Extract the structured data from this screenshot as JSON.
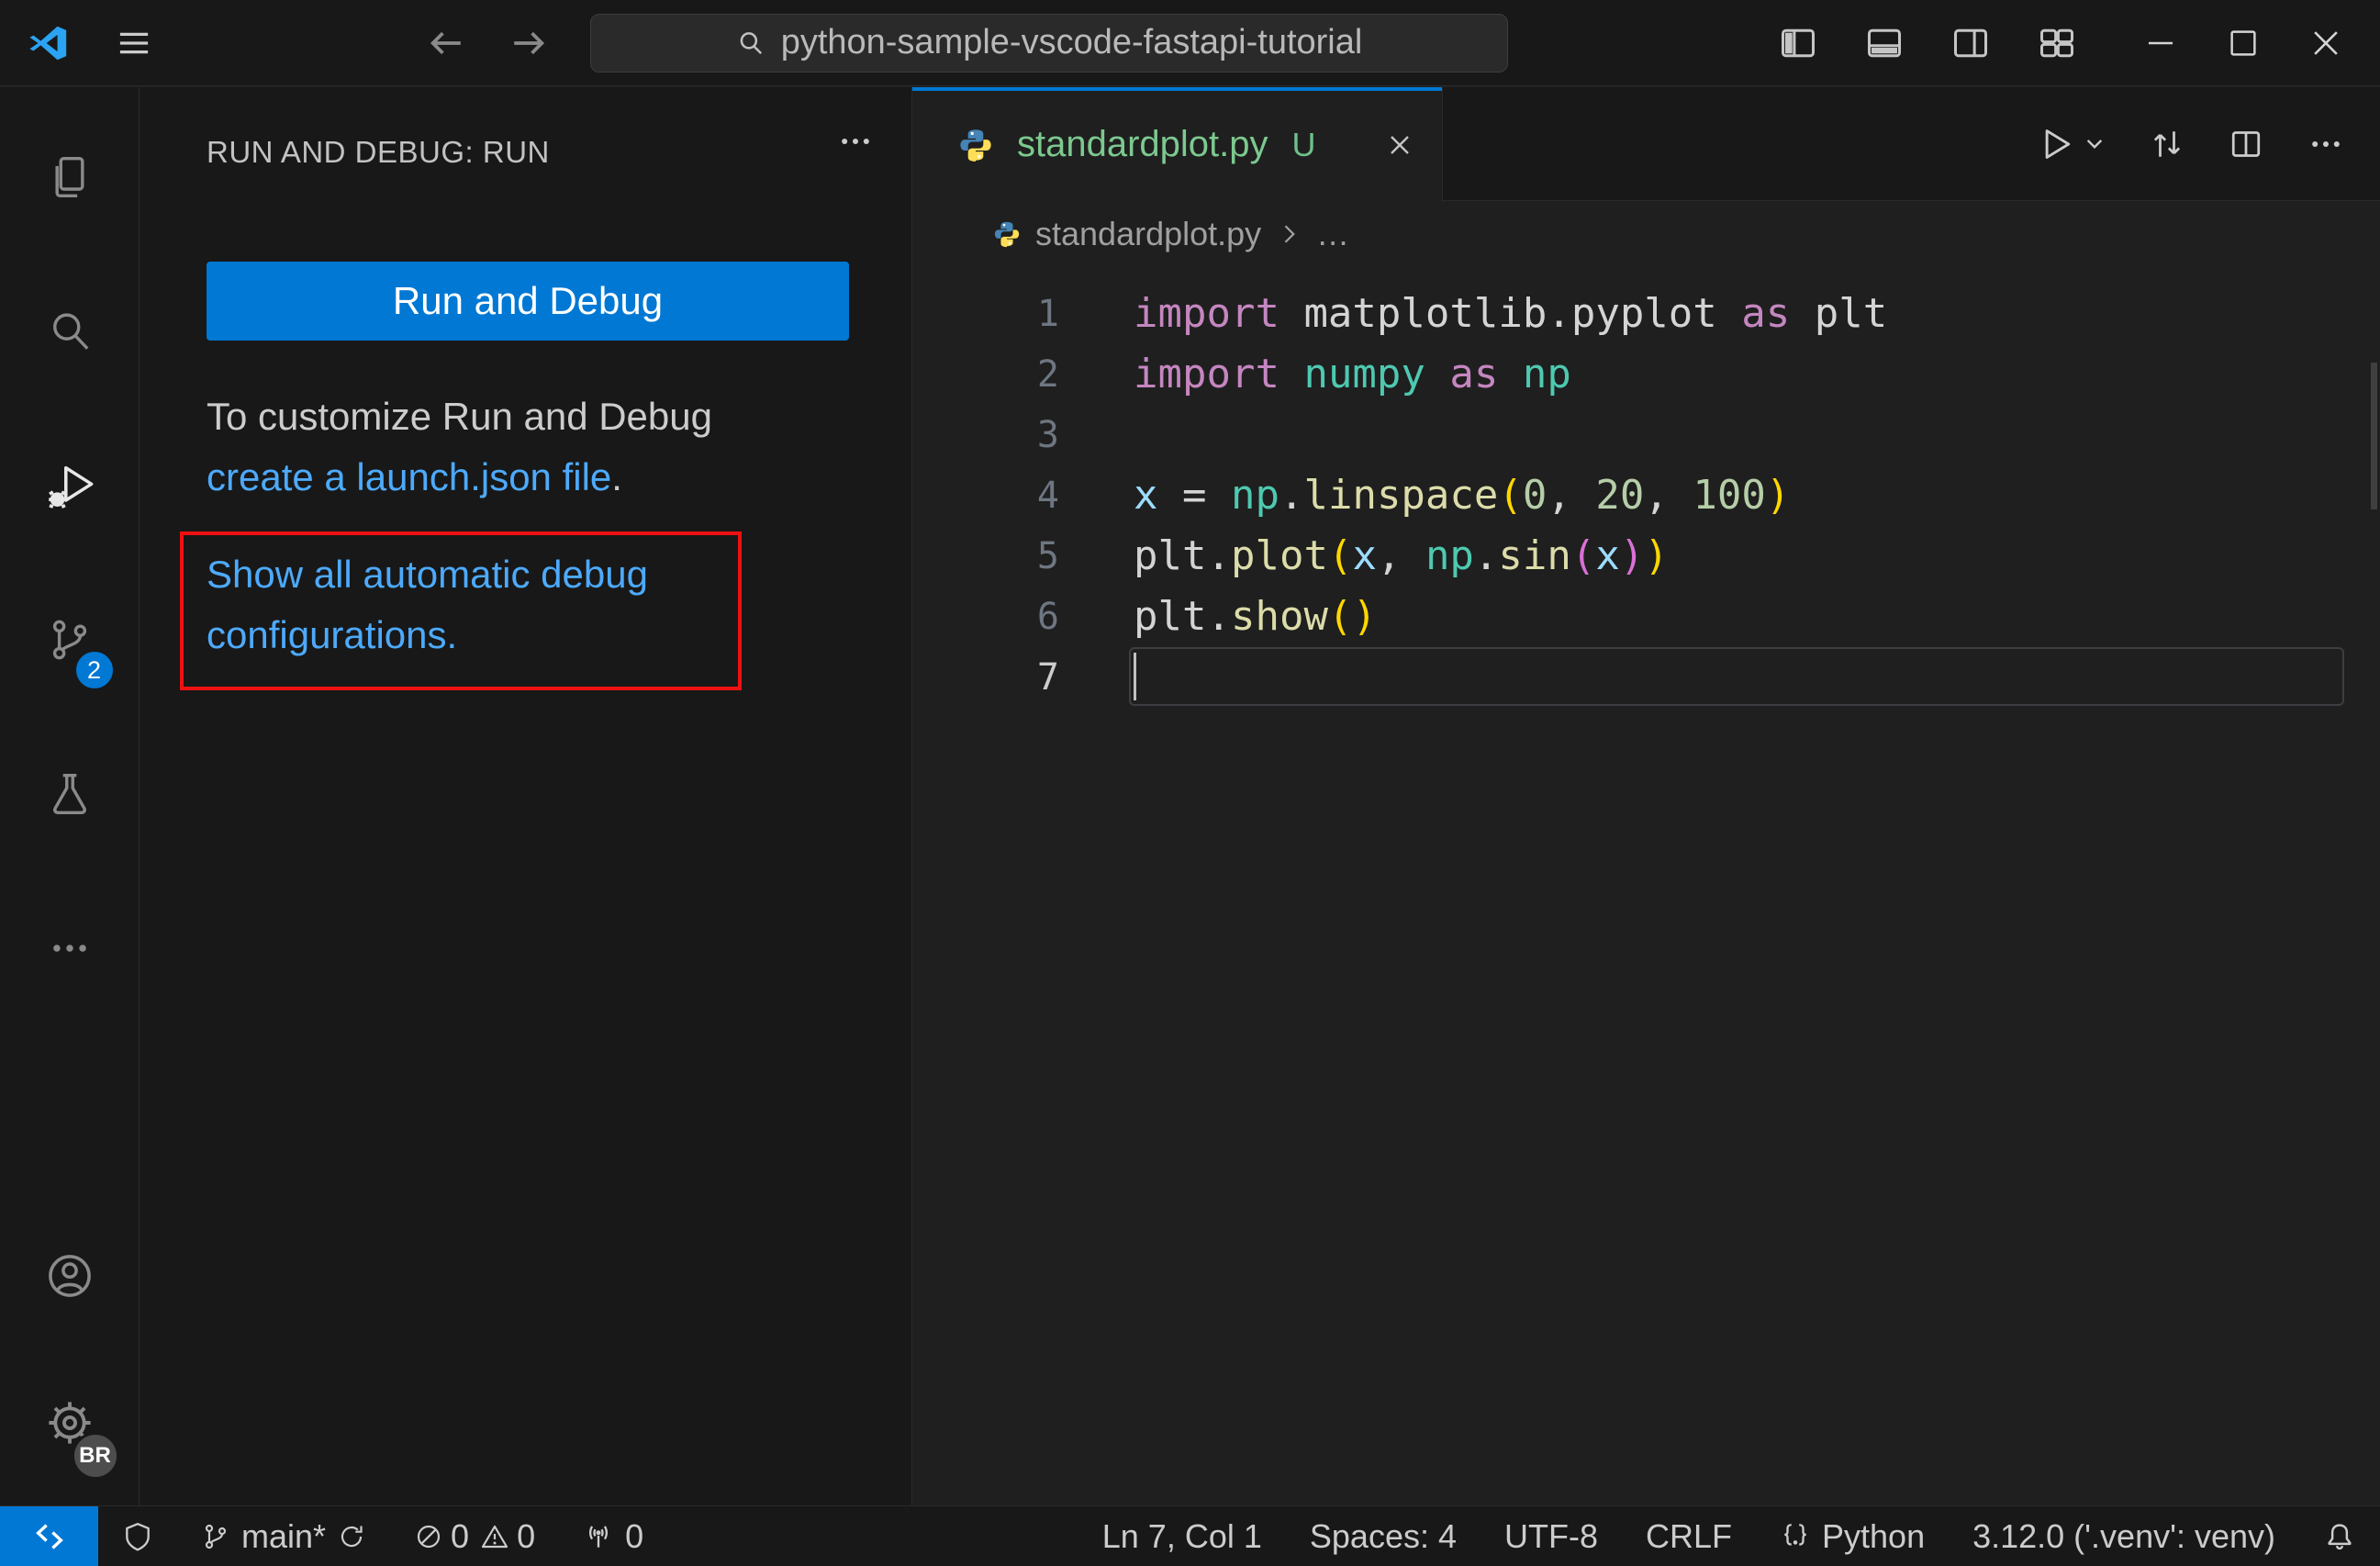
{
  "title_bar": {
    "search_text": "python-sample-vscode-fastapi-tutorial"
  },
  "activity_bar": {
    "scm_badge": "2",
    "profile_badge": "BR"
  },
  "sidebar": {
    "header": "RUN AND DEBUG: RUN",
    "run_button": "Run and Debug",
    "customize_text": "To customize Run and Debug",
    "launch_link": "create a launch.json file",
    "launch_suffix": ".",
    "autoconfig_link": "Show all automatic debug configurations."
  },
  "editor": {
    "tab_name": "standardplot.py",
    "tab_git": "U",
    "breadcrumb_file": "standardplot.py",
    "breadcrumb_more": "…",
    "active_line": 7,
    "code_lines": [
      [
        [
          "import",
          "kw"
        ],
        [
          " matplotlib.pyplot ",
          "txt"
        ],
        [
          "as",
          "kw"
        ],
        [
          " plt",
          "txt"
        ]
      ],
      [
        [
          "import",
          "kw"
        ],
        [
          " ",
          "txt"
        ],
        [
          "numpy",
          "mod"
        ],
        [
          " ",
          "txt"
        ],
        [
          "as",
          "kw"
        ],
        [
          " ",
          "txt"
        ],
        [
          "np",
          "mod"
        ]
      ],
      [],
      [
        [
          "x",
          "var"
        ],
        [
          " = ",
          "txt"
        ],
        [
          "np",
          "mod"
        ],
        [
          ".",
          "txt"
        ],
        [
          "linspace",
          "fn"
        ],
        [
          "(",
          "p1"
        ],
        [
          "0",
          "num"
        ],
        [
          ", ",
          "txt"
        ],
        [
          "20",
          "num"
        ],
        [
          ", ",
          "txt"
        ],
        [
          "100",
          "num"
        ],
        [
          ")",
          "p1"
        ]
      ],
      [
        [
          "plt",
          "txt"
        ],
        [
          ".",
          "txt"
        ],
        [
          "plot",
          "fn"
        ],
        [
          "(",
          "p1"
        ],
        [
          "x",
          "var"
        ],
        [
          ", ",
          "txt"
        ],
        [
          "np",
          "mod"
        ],
        [
          ".",
          "txt"
        ],
        [
          "sin",
          "fn"
        ],
        [
          "(",
          "p2"
        ],
        [
          "x",
          "var"
        ],
        [
          ")",
          "p2"
        ],
        [
          ")",
          "p1"
        ]
      ],
      [
        [
          "plt",
          "txt"
        ],
        [
          ".",
          "txt"
        ],
        [
          "show",
          "fn"
        ],
        [
          "(",
          "p1"
        ],
        [
          ")",
          "p1"
        ]
      ],
      []
    ]
  },
  "status_bar": {
    "branch": "main*",
    "errors": "0",
    "warnings": "0",
    "ports": "0",
    "cursor": "Ln 7, Col 1",
    "indent": "Spaces: 4",
    "encoding": "UTF-8",
    "eol": "CRLF",
    "language": "Python",
    "interpreter": "3.12.0 ('.venv': venv)"
  },
  "colors": {
    "accent_blue": "#0078d4",
    "link_blue": "#4daafc",
    "annotation_red": "#ee1111",
    "git_untracked_green": "#73c991",
    "editor_bg": "#1f1f1f",
    "panel_bg": "#181818"
  }
}
